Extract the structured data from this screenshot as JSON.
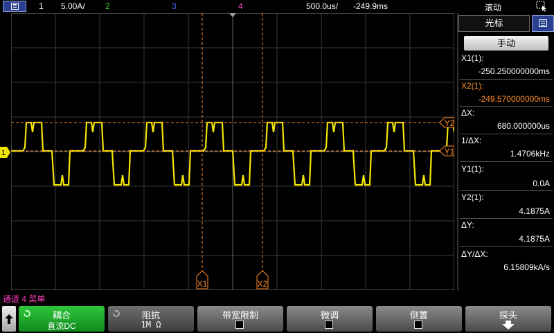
{
  "topbar": {
    "menu_icon": "menu-icon",
    "ch1_label": "1",
    "ch1_scale": "5.00A/",
    "ch2_label": "2",
    "ch3_label": "3",
    "ch4_label": "4",
    "timebase": "500.0us/",
    "delay": "-249.9ms",
    "mode": "滚动",
    "select_icon": "select-icon",
    "colors": {
      "ch1": "#f2e600",
      "ch2": "#3fd43f",
      "ch3": "#4a6cff",
      "ch4": "#ff3fbf"
    }
  },
  "screen": {
    "ground_marker": "1",
    "cursor_x1_label": "X1",
    "cursor_x2_label": "X2",
    "cursor_y1_label": "Y1",
    "cursor_y2_label": "Y2"
  },
  "cursor_panel": {
    "title": "光标",
    "mode_button": "手动",
    "x1_label": "X1(1):",
    "x1_value": "-250.250000000ms",
    "x2_label": "X2(1):",
    "x2_value": "-249.570000000ms",
    "dx_label": "ΔX:",
    "dx_value": "680.000000us",
    "inv_dx_label": "1/ΔX:",
    "inv_dx_value": "1.4706kHz",
    "y1_label": "Y1(1):",
    "y1_value": "0.0A",
    "y2_label": "Y2(1):",
    "y2_value": "4.1875A",
    "dy_label": "ΔY:",
    "dy_value": "4.1875A",
    "dydx_label": "ΔY/ΔX:",
    "dydx_value": "6.15809kA/s"
  },
  "status": {
    "text": "通道 4 菜单"
  },
  "softkeys": {
    "coupling_label": "耦合",
    "coupling_value": "直流DC",
    "impedance_label": "阻抗",
    "impedance_value": "1M Ω",
    "bw_limit_label": "带宽限制",
    "fine_label": "微调",
    "invert_label": "倒置",
    "probe_label": "探头"
  }
}
